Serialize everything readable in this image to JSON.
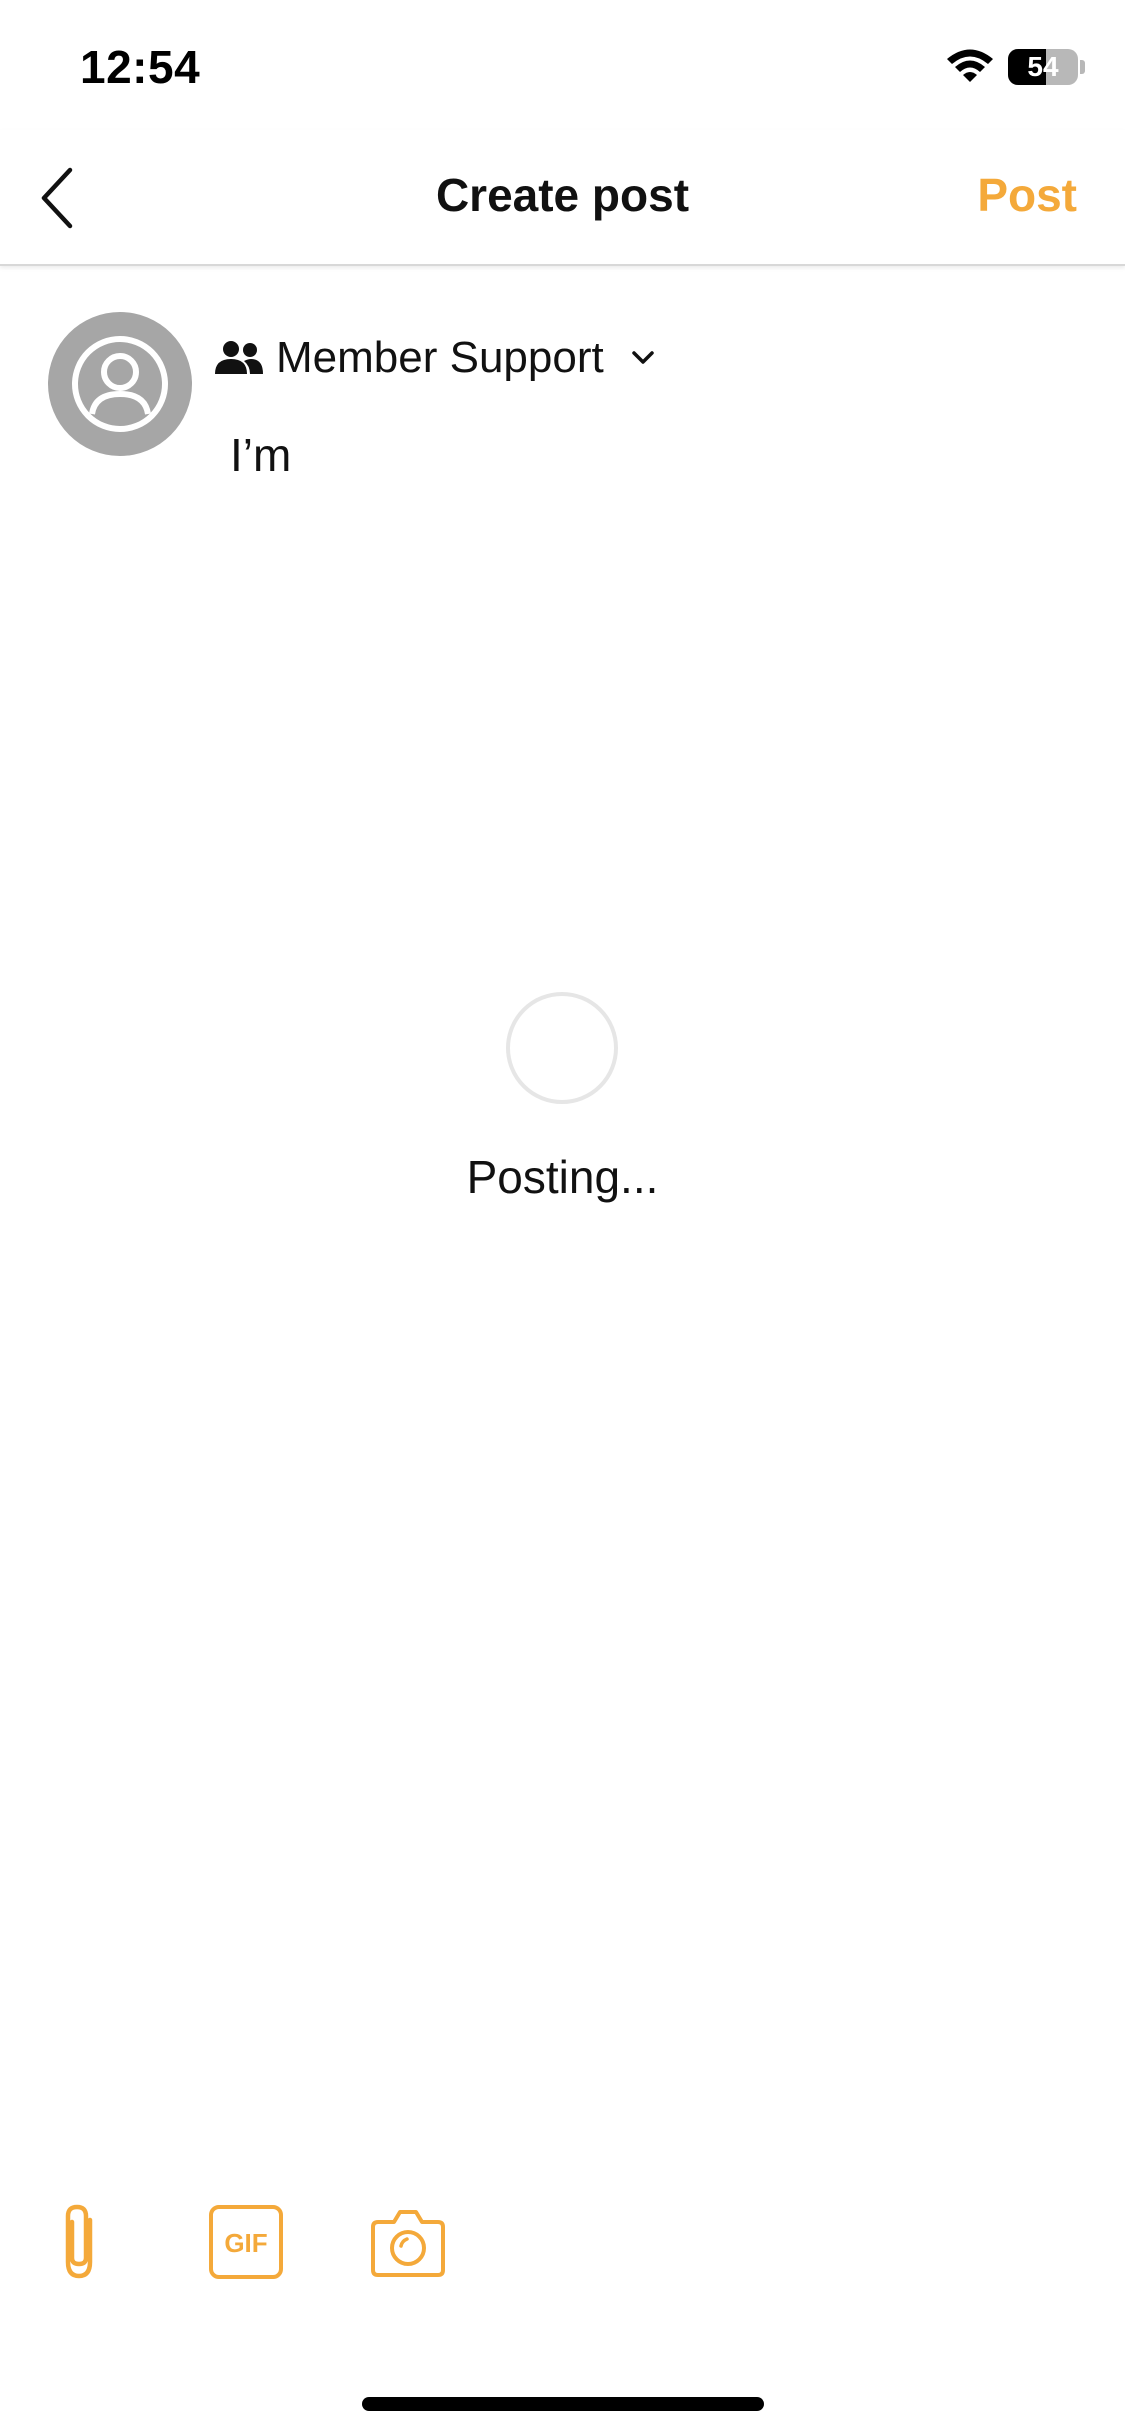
{
  "status_bar": {
    "time": "12:54",
    "battery_level": "54",
    "battery_fraction": 0.54,
    "wifi_icon": "wifi-icon"
  },
  "nav": {
    "back_icon": "chevron-left-icon",
    "title": "Create post",
    "post_label": "Post"
  },
  "composer": {
    "avatar_icon": "user-avatar-icon",
    "audience_icon": "group-icon",
    "audience_label": "Member Support",
    "audience_chevron_icon": "chevron-down-icon",
    "text": "I’m"
  },
  "loading": {
    "label": "Posting..."
  },
  "toolbar": {
    "items": [
      "attach-icon",
      "gif-icon",
      "camera-icon"
    ],
    "gif_text": "GIF"
  },
  "colors": {
    "accent": "#f4a93a",
    "avatar_bg": "#a6a6a6",
    "text": "#111111",
    "spinner_track": "#e6e6e6"
  }
}
